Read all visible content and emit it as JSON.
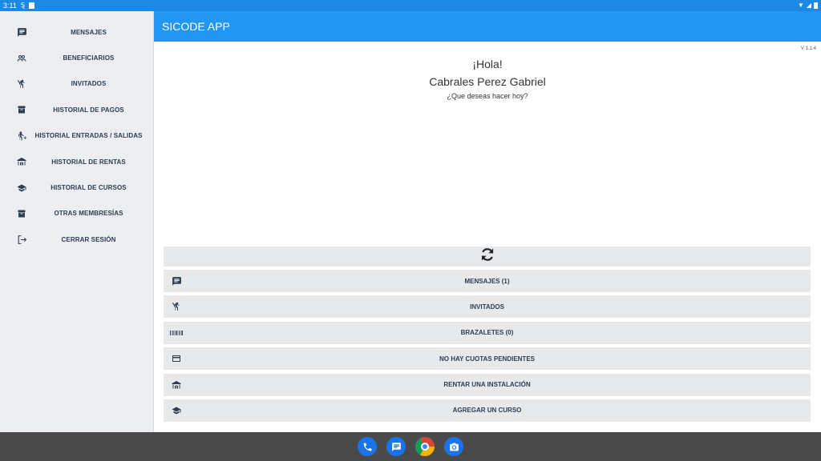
{
  "statusbar": {
    "time": "3:11"
  },
  "app": {
    "title": "SICODE APP",
    "version": "V 1.1.4"
  },
  "greeting": {
    "hello": "¡Hola!",
    "name": "Cabrales Perez Gabriel",
    "question": "¿Que deseas hacer hoy?"
  },
  "sidebar": {
    "items": [
      {
        "label": "MENSAJES",
        "icon": "message-icon"
      },
      {
        "label": "BENEFICIARIOS",
        "icon": "people-icon"
      },
      {
        "label": "INVITADOS",
        "icon": "guest-icon"
      },
      {
        "label": "HISTORIAL DE PAGOS",
        "icon": "archive-icon"
      },
      {
        "label": "HISTORIAL ENTRADAS / SALIDAS",
        "icon": "walk-icon"
      },
      {
        "label": "HISTORIAL DE RENTAS",
        "icon": "facility-icon"
      },
      {
        "label": "HISTORIAL DE CURSOS",
        "icon": "graduation-cap-icon"
      },
      {
        "label": "OTRAS MEMBRESÍAS",
        "icon": "archive-icon"
      },
      {
        "label": "CERRAR SESIÓN",
        "icon": "logout-icon"
      }
    ]
  },
  "actions": [
    {
      "label": "MENSAJES (1)",
      "icon": "message-icon"
    },
    {
      "label": "INVITADOS",
      "icon": "guest-icon"
    },
    {
      "label": "BRAZALETES (0)",
      "icon": "barcode-icon"
    },
    {
      "label": "NO HAY CUOTAS PENDIENTES",
      "icon": "credit-card-icon"
    },
    {
      "label": "RENTAR UNA INSTALACIÓN",
      "icon": "facility-icon"
    },
    {
      "label": "AGREGAR UN CURSO",
      "icon": "graduation-cap-icon"
    }
  ],
  "dock": [
    "phone-icon",
    "messages-icon",
    "chrome-icon",
    "camera-icon"
  ],
  "colors": {
    "primary": "#2196f3",
    "statusbar": "#1e88e5",
    "sidebar": "#eceef1",
    "button": "#e8e9eb",
    "text": "#2c3e50"
  }
}
